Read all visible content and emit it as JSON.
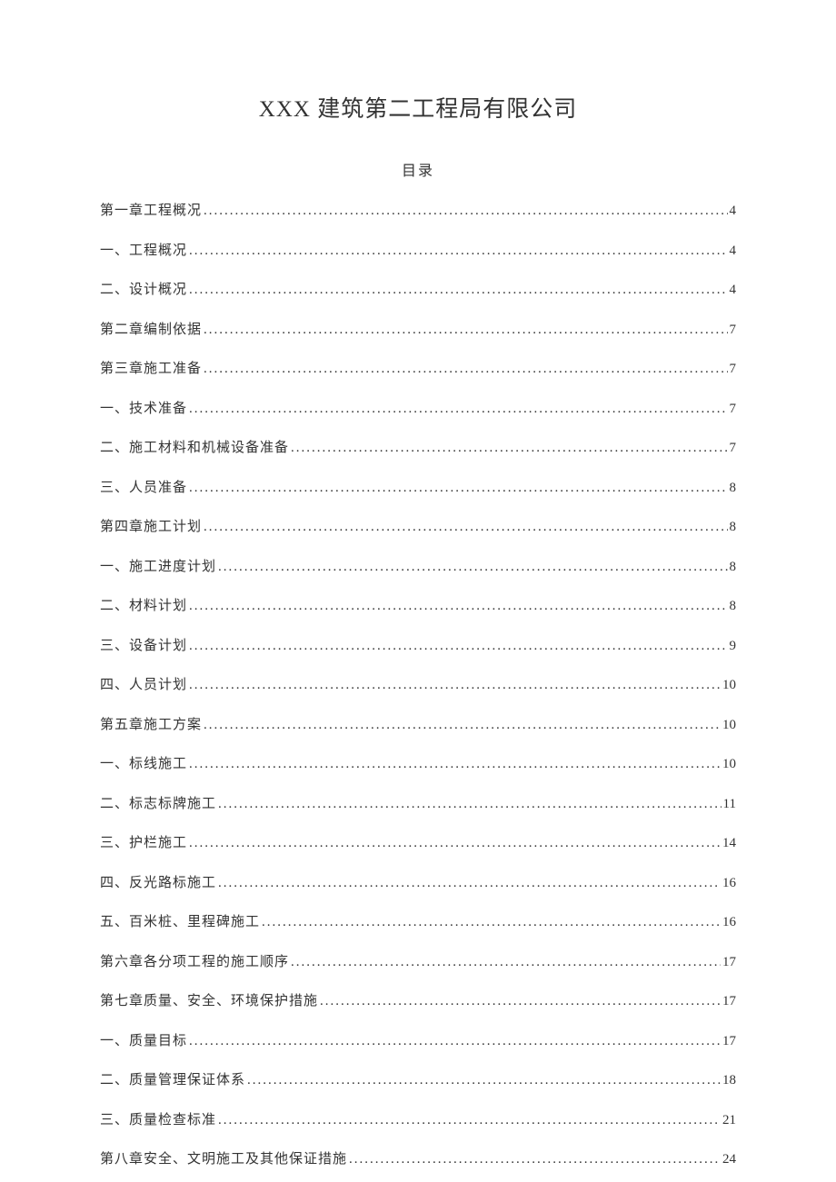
{
  "header": {
    "title": "XXX 建筑第二工程局有限公司",
    "toc_heading": "目录"
  },
  "toc": [
    {
      "label": "第一章工程概况",
      "page": "4"
    },
    {
      "label": "一、工程概况",
      "page": "4"
    },
    {
      "label": "二、设计概况",
      "page": "4"
    },
    {
      "label": "第二章编制依据",
      "page": "7"
    },
    {
      "label": "第三章施工准备",
      "page": "7"
    },
    {
      "label": "一、技术准备",
      "page": "7"
    },
    {
      "label": "二、施工材料和机械设备准备",
      "page": "7"
    },
    {
      "label": "三、人员准备",
      "page": "8"
    },
    {
      "label": "第四章施工计划",
      "page": "8"
    },
    {
      "label": "一、施工进度计划",
      "page": "8"
    },
    {
      "label": "二、材料计划",
      "page": "8"
    },
    {
      "label": "三、设备计划",
      "page": "9"
    },
    {
      "label": "四、人员计划",
      "page": "10"
    },
    {
      "label": "第五章施工方案",
      "page": "10"
    },
    {
      "label": "一、标线施工",
      "page": "10"
    },
    {
      "label": "二、标志标牌施工",
      "page": "11"
    },
    {
      "label": "三、护栏施工",
      "page": "14"
    },
    {
      "label": "四、反光路标施工",
      "page": "16"
    },
    {
      "label": "五、百米桩、里程碑施工",
      "page": "16"
    },
    {
      "label": "第六章各分项工程的施工顺序",
      "page": "17"
    },
    {
      "label": "第七章质量、安全、环境保护措施",
      "page": "17"
    },
    {
      "label": "一、质量目标",
      "page": "17"
    },
    {
      "label": "二、质量管理保证体系",
      "page": "18"
    },
    {
      "label": "三、质量检查标准",
      "page": "21"
    },
    {
      "label": "第八章安全、文明施工及其他保证措施",
      "page": "24"
    }
  ]
}
